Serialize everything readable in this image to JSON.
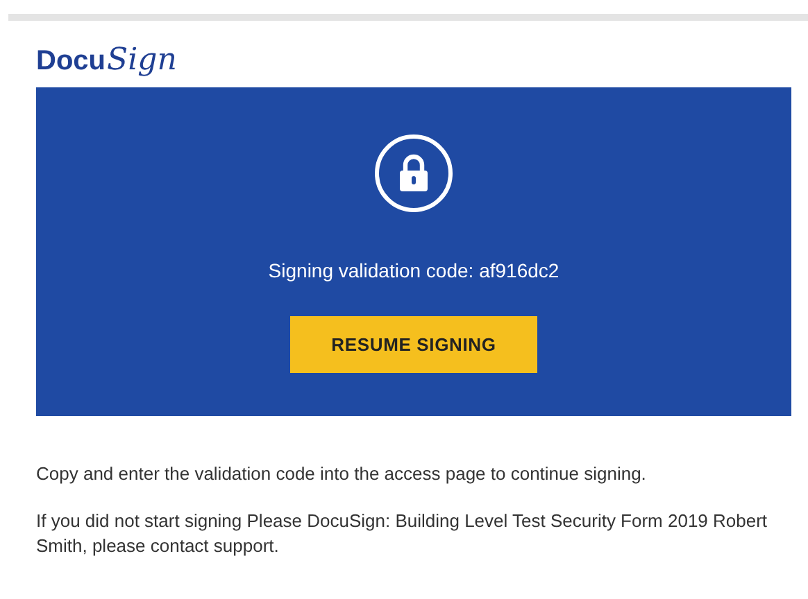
{
  "logo": {
    "main": "Docu",
    "script": "Sign"
  },
  "banner": {
    "code_text": "Signing validation code: af916dc2",
    "button": "RESUME SIGNING"
  },
  "paragraphs": [
    "Copy and enter the validation code into the access page to continue signing.",
    "If you did not start signing Please DocuSign: Building Level Test Security Form 2019 Robert Smith, please contact support."
  ]
}
